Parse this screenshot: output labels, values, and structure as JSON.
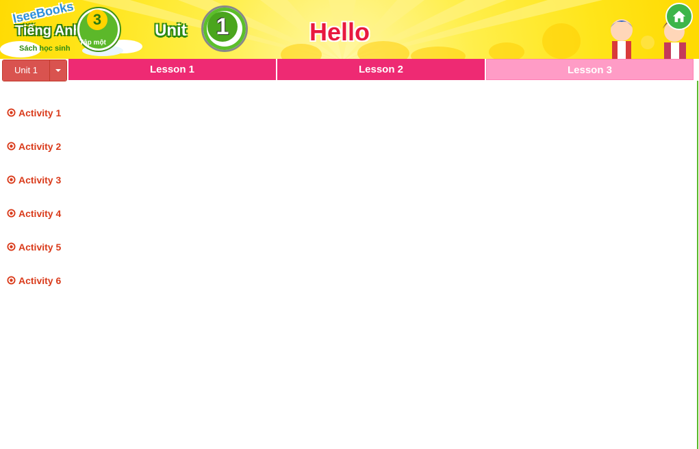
{
  "header": {
    "logo": {
      "brand": "IseeBooks",
      "title": "Tiếng Anh",
      "subtitle": "Sách học sinh",
      "grade": "3",
      "volume": "Tập một"
    },
    "unit_label": "Unit",
    "unit_number": "1",
    "page_title": "Hello",
    "home_icon": "home-icon"
  },
  "nav": {
    "unit_select": {
      "selected": "Unit 1",
      "caret_icon": "caret-down-icon"
    },
    "tabs": [
      {
        "label": "Lesson 1",
        "state": "normal"
      },
      {
        "label": "Lesson 2",
        "state": "normal"
      },
      {
        "label": "Lesson 3",
        "state": "active"
      }
    ]
  },
  "activities": [
    {
      "label": "Activity 1"
    },
    {
      "label": "Activity 2"
    },
    {
      "label": "Activity 3"
    },
    {
      "label": "Activity 4"
    },
    {
      "label": "Activity 5"
    },
    {
      "label": "Activity 6"
    }
  ],
  "colors": {
    "header_yellow": "#ffe51a",
    "tab_pink": "#ee2a73",
    "tab_active": "#ff9cc6",
    "activity_text": "#d93a1a",
    "title_red": "#e8193f",
    "home_green": "#3db54a"
  }
}
